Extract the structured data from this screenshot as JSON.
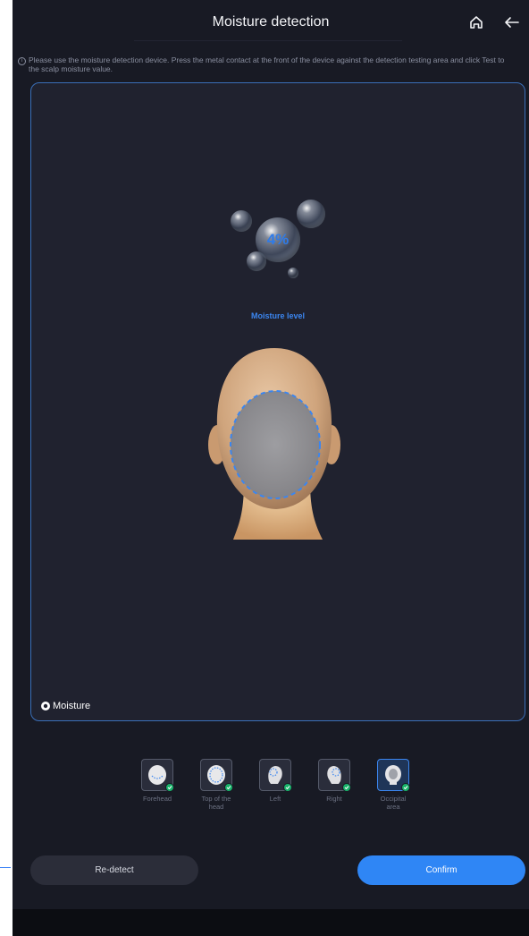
{
  "header": {
    "title": "Moisture detection",
    "home_icon": "home-icon",
    "back_icon": "back-arrow-icon"
  },
  "info": {
    "icon": "info-icon",
    "line1": "Please use the moisture detection device. Press the metal contact at the front of the device against the detection testing area and click Test to",
    "line2": "the scalp moisture value."
  },
  "result": {
    "moisture_value": "4%",
    "moisture_label": "Moisture level"
  },
  "legend": {
    "label": "Moisture"
  },
  "areas": [
    {
      "label": "Forehead",
      "checked": true,
      "active": false
    },
    {
      "label": "Top of the head",
      "checked": true,
      "active": false
    },
    {
      "label": "Left",
      "checked": true,
      "active": false
    },
    {
      "label": "Right",
      "checked": true,
      "active": false
    },
    {
      "label": "Occipital area",
      "checked": true,
      "active": true
    }
  ],
  "buttons": {
    "redetect": "Re-detect",
    "confirm": "Confirm"
  },
  "colors": {
    "accent": "#2f86f5",
    "background": "#181a24",
    "panel": "#20222f",
    "check": "#19b36b"
  }
}
